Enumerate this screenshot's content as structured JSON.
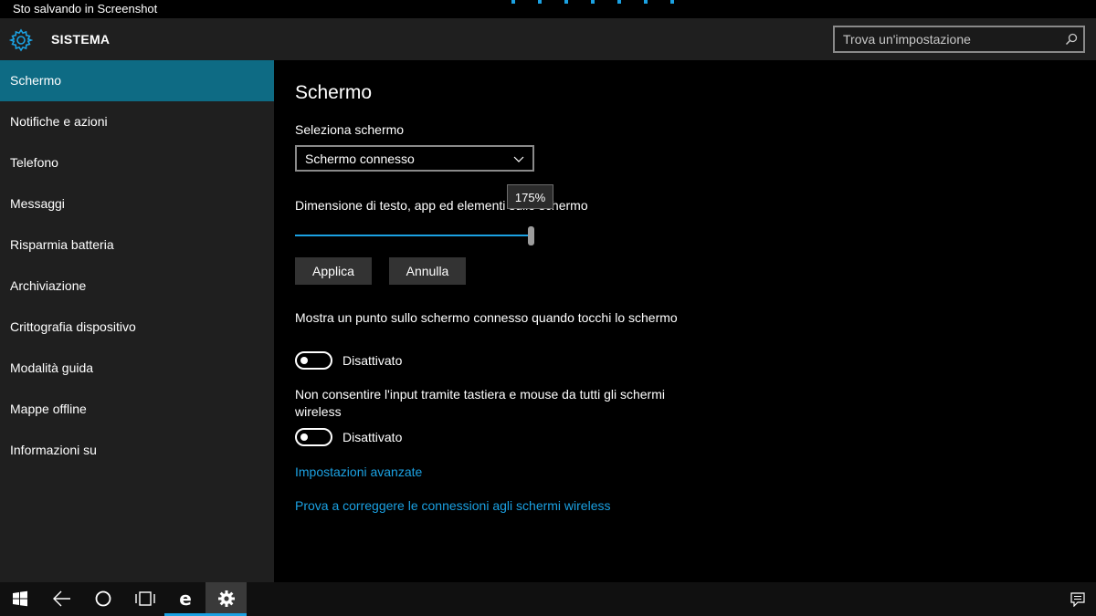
{
  "statusbar": {
    "text": "Sto salvando in Screenshot"
  },
  "header": {
    "title": "SISTEMA",
    "search_placeholder": "Trova un'impostazione"
  },
  "sidebar": {
    "items": [
      {
        "label": "Schermo",
        "active": true
      },
      {
        "label": "Notifiche e azioni"
      },
      {
        "label": "Telefono"
      },
      {
        "label": "Messaggi"
      },
      {
        "label": "Risparmia batteria"
      },
      {
        "label": "Archiviazione"
      },
      {
        "label": "Crittografia dispositivo"
      },
      {
        "label": "Modalità guida"
      },
      {
        "label": "Mappe offline"
      },
      {
        "label": "Informazioni su"
      }
    ]
  },
  "main": {
    "title": "Schermo",
    "select_label": "Seleziona schermo",
    "select_value": "Schermo connesso",
    "slider_label": "Dimensione di testo, app ed elementi sullo schermo",
    "slider_tooltip": "175%",
    "slider_value_fraction": 1.0,
    "apply_label": "Applica",
    "cancel_label": "Annulla",
    "option1_text": "Mostra un punto sullo schermo connesso quando tocchi lo schermo",
    "option1_state": "Disattivato",
    "option2_text": "Non consentire l'input tramite tastiera e mouse da tutti gli schermi wireless",
    "option2_state": "Disattivato",
    "link_advanced": "Impostazioni avanzate",
    "link_fix": "Prova a correggere le connessioni agli schermi wireless"
  },
  "taskbar": {
    "icons": [
      "windows-icon",
      "back-icon",
      "cortana-icon",
      "task-view-icon",
      "edge-icon",
      "settings-icon"
    ],
    "right_icon": "action-center-icon"
  },
  "colors": {
    "accent": "#1ba1e2",
    "active_nav": "#0e6b84",
    "panel": "#1f1f1f"
  }
}
